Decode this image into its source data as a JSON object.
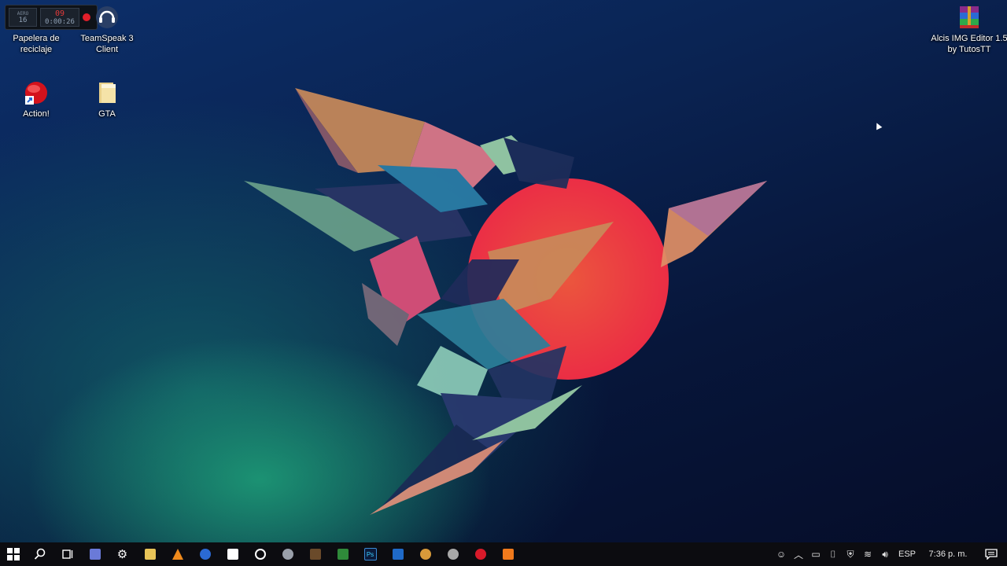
{
  "desktop": {
    "icons": {
      "recycle_bin": "Papelera de reciclaje",
      "teamspeak": "TeamSpeak 3 Client",
      "action": "Action!",
      "gta": "GTA",
      "alcis": "Alcis IMG Editor 1.5 by TutosTT"
    },
    "widget": {
      "brand": "AERO",
      "count": "16",
      "timer_top": "09",
      "timer_bottom": "0:00:26"
    }
  },
  "taskbar": {
    "apps": [
      "start-icon",
      "search-icon",
      "task-view-icon",
      "discord-icon",
      "settings-icon",
      "file-explorer-icon",
      "vlc-icon",
      "browser-icon",
      "store-icon",
      "media-icon",
      "app-icon",
      "minecraft-icon",
      "excel-icon",
      "photoshop-icon",
      "outlook-icon",
      "game-icon",
      "spy-icon",
      "opera-icon",
      "app-orange-icon"
    ],
    "tray": {
      "language": "ESP",
      "clock": "7:36 p. m."
    }
  },
  "colors": {
    "wallpaper_dark": "#050d29",
    "wallpaper_teal": "#1ea078",
    "sun": "#ff4a3a",
    "taskbar": "#0c0c10"
  }
}
